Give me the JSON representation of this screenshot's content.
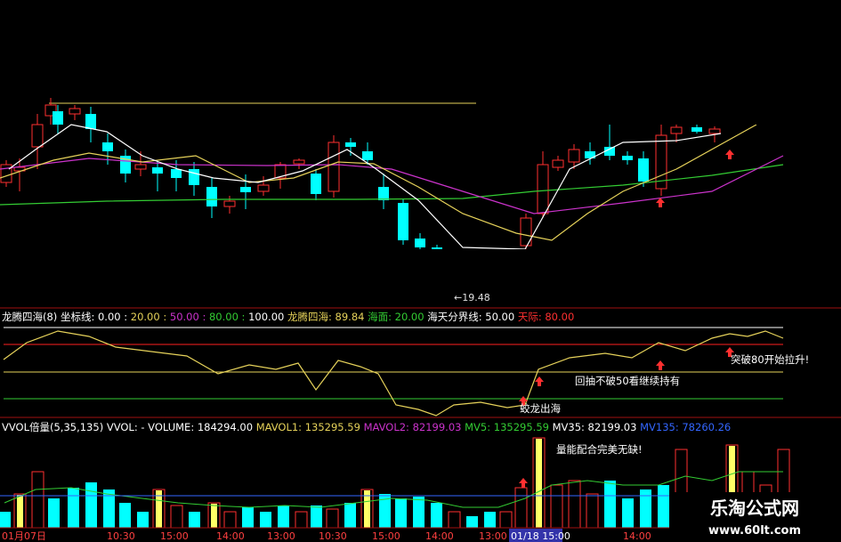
{
  "main_chart": {
    "price_marker": "←19.48",
    "colors": {
      "up": "#ff3030",
      "down": "#00ffff",
      "ma5": "#ffffff",
      "ma10": "#e6d25a",
      "ma20": "#cc33cc",
      "ma60": "#33cc33",
      "bg": "#000000"
    }
  },
  "indicator": {
    "header": [
      {
        "text": "龙腾四海(8) 坐标线: 0.00 : ",
        "color": "#ffffff"
      },
      {
        "text": "20.00 : ",
        "color": "#e6d25a"
      },
      {
        "text": "50.00 : ",
        "color": "#cc33cc"
      },
      {
        "text": "80.00 : ",
        "color": "#33cc33"
      },
      {
        "text": "100.00  ",
        "color": "#ffffff"
      },
      {
        "text": "龙腾四海: 89.84  ",
        "color": "#e6d25a"
      },
      {
        "text": "海面: 20.00  ",
        "color": "#33cc33"
      },
      {
        "text": "海天分界线: 50.00  ",
        "color": "#ffffff"
      },
      {
        "text": "天际: 80.00",
        "color": "#ff3030"
      }
    ],
    "annotations": {
      "break80": "突破80开始拉升!",
      "pullback50": "回抽不破50看继续持有",
      "dragon_out": "蛟龙出海"
    }
  },
  "volume": {
    "header": [
      {
        "text": "VVOL倍量(5,35,135) VVOL: -   ",
        "color": "#ffffff"
      },
      {
        "text": "VOLUME: 184294.00  ",
        "color": "#ffffff"
      },
      {
        "text": "MAVOL1: 135295.59  ",
        "color": "#e6d25a"
      },
      {
        "text": "MAVOL2: 82199.03  ",
        "color": "#cc33cc"
      },
      {
        "text": "MV5: 135295.59  ",
        "color": "#33cc33"
      },
      {
        "text": "MV35: 82199.03  ",
        "color": "#ffffff"
      },
      {
        "text": "MV135: 78260.26",
        "color": "#3366ff"
      }
    ],
    "annotation": "量能配合完美无缺!"
  },
  "time_axis": {
    "labels": [
      "01月07日",
      "10:30",
      "15:00",
      "14:00",
      "13:00",
      "10:30",
      "15:00",
      "14:00",
      "13:00",
      "01/18 15:00",
      "14:00"
    ],
    "highlight_index": 9
  },
  "watermark": {
    "title": "乐淘公式网",
    "url": "www.60lt.com"
  }
}
